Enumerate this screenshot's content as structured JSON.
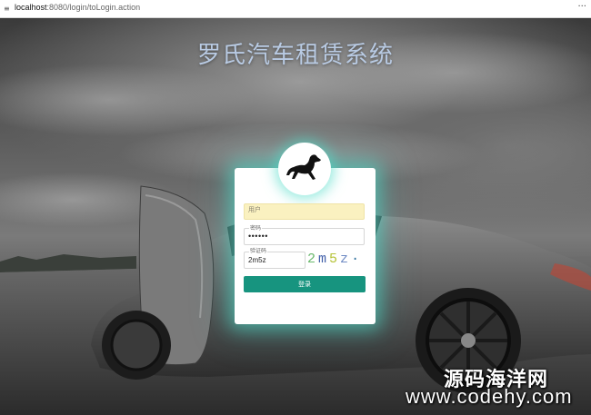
{
  "browser": {
    "url_host": "localhost",
    "url_rest": ":8080/login/toLogin.action",
    "menu_glyph": "···",
    "site_icon": "settings-sliders-icon"
  },
  "page": {
    "title": "罗氏汽车租赁系统",
    "title_color": "#b9cbe4",
    "logo_icon": "horse-icon"
  },
  "login_form": {
    "username_placeholder": "用户",
    "username_fill_color": "#faf1c0",
    "password_label": "密码",
    "password_value": "••••••",
    "captcha_label": "验证码",
    "captcha_value": "2m5z",
    "captcha_image_chars": [
      {
        "char": "2",
        "color": "#69b86b"
      },
      {
        "char": "m",
        "color": "#3f5ea8"
      },
      {
        "char": "5",
        "color": "#b6c338"
      },
      {
        "char": "z",
        "color": "#6f8bc4"
      },
      {
        "char": "·",
        "color": "#2c6f9c"
      }
    ],
    "login_button_label": "登录",
    "accent_color": "#17947f",
    "glow_color": "#50dcc8"
  },
  "watermark": {
    "line1": "源码海洋网",
    "line2": "www.codehy.com"
  }
}
